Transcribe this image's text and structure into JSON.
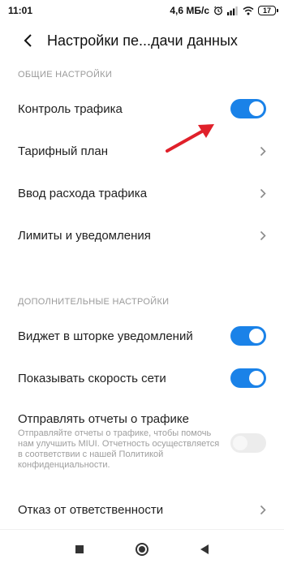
{
  "status_bar": {
    "time": "11:01",
    "speed": "4,6 МБ/с",
    "battery": "17"
  },
  "header": {
    "title": "Настройки пе...дачи данных"
  },
  "sections": {
    "general": "ОБЩИЕ НАСТРОЙКИ",
    "additional": "ДОПОЛНИТЕЛЬНЫЕ НАСТРОЙКИ"
  },
  "items": {
    "traffic_control": {
      "label": "Контроль трафика",
      "enabled": true
    },
    "tariff_plan": {
      "label": "Тарифный план"
    },
    "traffic_input": {
      "label": "Ввод расхода трафика"
    },
    "limits": {
      "label": "Лимиты и уведомления"
    },
    "widget": {
      "label": "Виджет в шторке уведомлений",
      "enabled": true
    },
    "speed": {
      "label": "Показывать скорость сети",
      "enabled": true
    },
    "reports": {
      "label": "Отправлять отчеты о трафике",
      "description": "Отправляйте отчеты о трафике, чтобы помочь нам улучшить MIUI. Отчетность осуществляется в соответствии с нашей Политикой конфиденциальности.",
      "enabled": false
    },
    "disclaimer": {
      "label": "Отказ от ответственности"
    }
  },
  "colors": {
    "accent": "#1a82e8",
    "annotation": "#e0202a"
  }
}
